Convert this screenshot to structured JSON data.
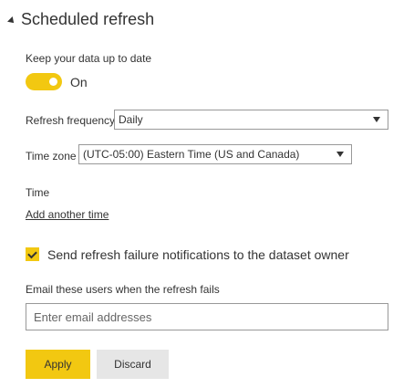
{
  "section": {
    "title": "Scheduled refresh",
    "caret_icon": "caret-down-right-icon"
  },
  "keep_up_to_date": {
    "label": "Keep your data up to date",
    "toggle_state": "On",
    "toggle_color": "#f2c811"
  },
  "refresh_frequency": {
    "label": "Refresh frequency",
    "selected": "Daily"
  },
  "time_zone": {
    "label": "Time zone",
    "selected": "(UTC-05:00) Eastern Time (US and Canada)"
  },
  "time": {
    "label": "Time",
    "add_link": "Add another time"
  },
  "notifications": {
    "checked": true,
    "label": "Send refresh failure notifications to the dataset owner"
  },
  "email": {
    "label": "Email these users when the refresh fails",
    "placeholder": "Enter email addresses",
    "value": ""
  },
  "actions": {
    "apply_label": "Apply",
    "discard_label": "Discard"
  }
}
